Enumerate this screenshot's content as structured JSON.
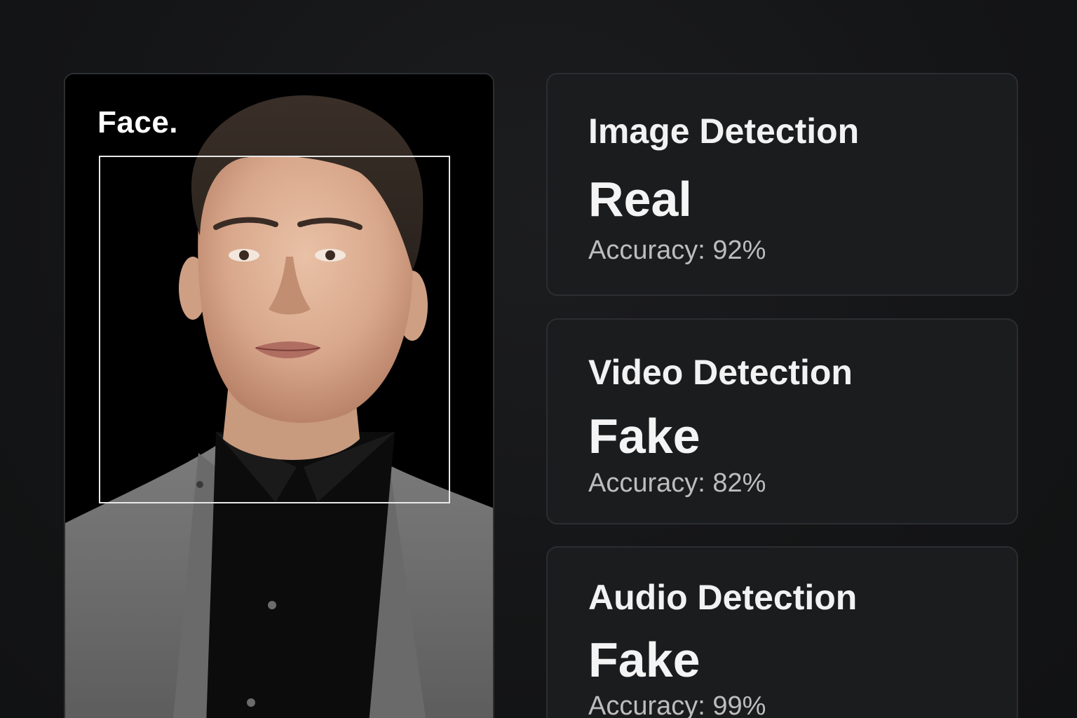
{
  "photo_panel": {
    "label": "Face."
  },
  "cards": [
    {
      "title": "Image Detection",
      "verdict": "Real",
      "accuracy_text": "Accuracy: 92%",
      "accuracy_pct": 92
    },
    {
      "title": "Video Detection",
      "verdict": "Fake",
      "accuracy_text": "Accuracy: 82%",
      "accuracy_pct": 82
    },
    {
      "title": "Audio Detection",
      "verdict": "Fake",
      "accuracy_text": "Accuracy: 99%",
      "accuracy_pct": 99
    }
  ],
  "colors": {
    "background": "#151617",
    "card_background": "#1b1c1e",
    "card_border": "#2c2d30",
    "title_text": "#f2f2f2",
    "accuracy_text": "#bdbdbd",
    "face_box": "#e8e8e8"
  }
}
